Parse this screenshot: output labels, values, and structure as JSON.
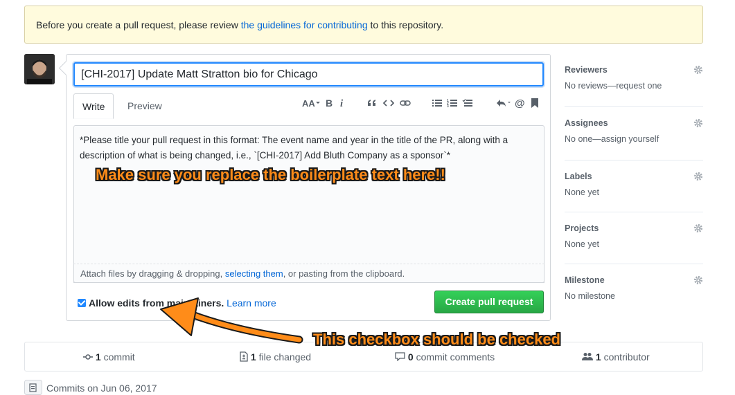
{
  "notice": {
    "prefix": "Before you create a pull request, please review ",
    "link": "the guidelines for contributing",
    "suffix": " to this repository."
  },
  "form": {
    "title_value": "[CHI-2017] Update Matt Stratton bio for Chicago",
    "tabs": [
      "Write",
      "Preview"
    ],
    "body_text": "*Please title your pull request in this format: The event name and year in the title of the PR, along with a description of what is being changed, i.e., `[CHI-2017] Add Bluth Company as a sponsor`*",
    "attach_prefix": "Attach files by dragging & dropping, ",
    "attach_link": "selecting them",
    "attach_suffix": ", or pasting from the clipboard.",
    "allow_edits_label": "Allow edits from maintainers.",
    "learn_more": "Learn more",
    "create_button": "Create pull request",
    "allow_edits_checked": true
  },
  "toolbar": {
    "icons": [
      "text-size-icon",
      "bold-icon",
      "italic-icon",
      "quote-icon",
      "code-icon",
      "link-icon",
      "unordered-list-icon",
      "ordered-list-icon",
      "task-list-icon",
      "reply-icon",
      "mention-icon",
      "bookmark-icon"
    ]
  },
  "sidebar": {
    "sections": [
      {
        "title": "Reviewers",
        "value": "No reviews—request one"
      },
      {
        "title": "Assignees",
        "value": "No one—assign yourself"
      },
      {
        "title": "Labels",
        "value": "None yet"
      },
      {
        "title": "Projects",
        "value": "None yet"
      },
      {
        "title": "Milestone",
        "value": "No milestone"
      }
    ]
  },
  "stats": {
    "commits_count": "1",
    "commits_label": " commit",
    "files_count": "1",
    "files_label": " file changed",
    "comments_count": "0",
    "comments_label": " commit comments",
    "contributors_count": "1",
    "contributors_label": " contributor"
  },
  "commits_header": "Commits on Jun 06, 2017",
  "annotations": {
    "replace_text": "Make sure you replace the boilerplate text here!!",
    "checkbox_text": "This checkbox should be checked",
    "color": "#ff8c19"
  }
}
